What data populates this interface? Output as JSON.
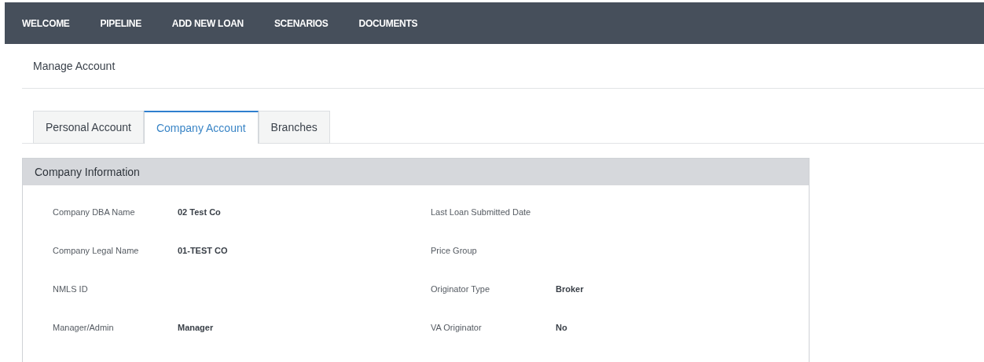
{
  "nav": [
    {
      "label": "WELCOME"
    },
    {
      "label": "PIPELINE"
    },
    {
      "label": "ADD NEW LOAN"
    },
    {
      "label": "SCENARIOS"
    },
    {
      "label": "DOCUMENTS"
    }
  ],
  "page_title": "Manage Account",
  "tabs": [
    {
      "label": "Personal Account",
      "selected": false
    },
    {
      "label": "Company Account",
      "selected": true
    },
    {
      "label": "Branches",
      "selected": false
    }
  ],
  "panel": {
    "title": "Company Information",
    "rows": [
      [
        {
          "label": "Company DBA Name",
          "value": "02 Test Co"
        },
        {
          "label": "Last Loan Submitted Date"
        }
      ],
      [
        {
          "label": "Company Legal Name",
          "value": "01-TEST CO"
        },
        {
          "label": "Price Group"
        }
      ],
      [
        {
          "label": "NMLS ID"
        },
        {
          "label": "Originator Type",
          "value": "Broker"
        }
      ],
      [
        {
          "label": "Manager/Admin",
          "value": "Manager"
        },
        {
          "label": "VA Originator",
          "value": "No"
        }
      ]
    ]
  }
}
